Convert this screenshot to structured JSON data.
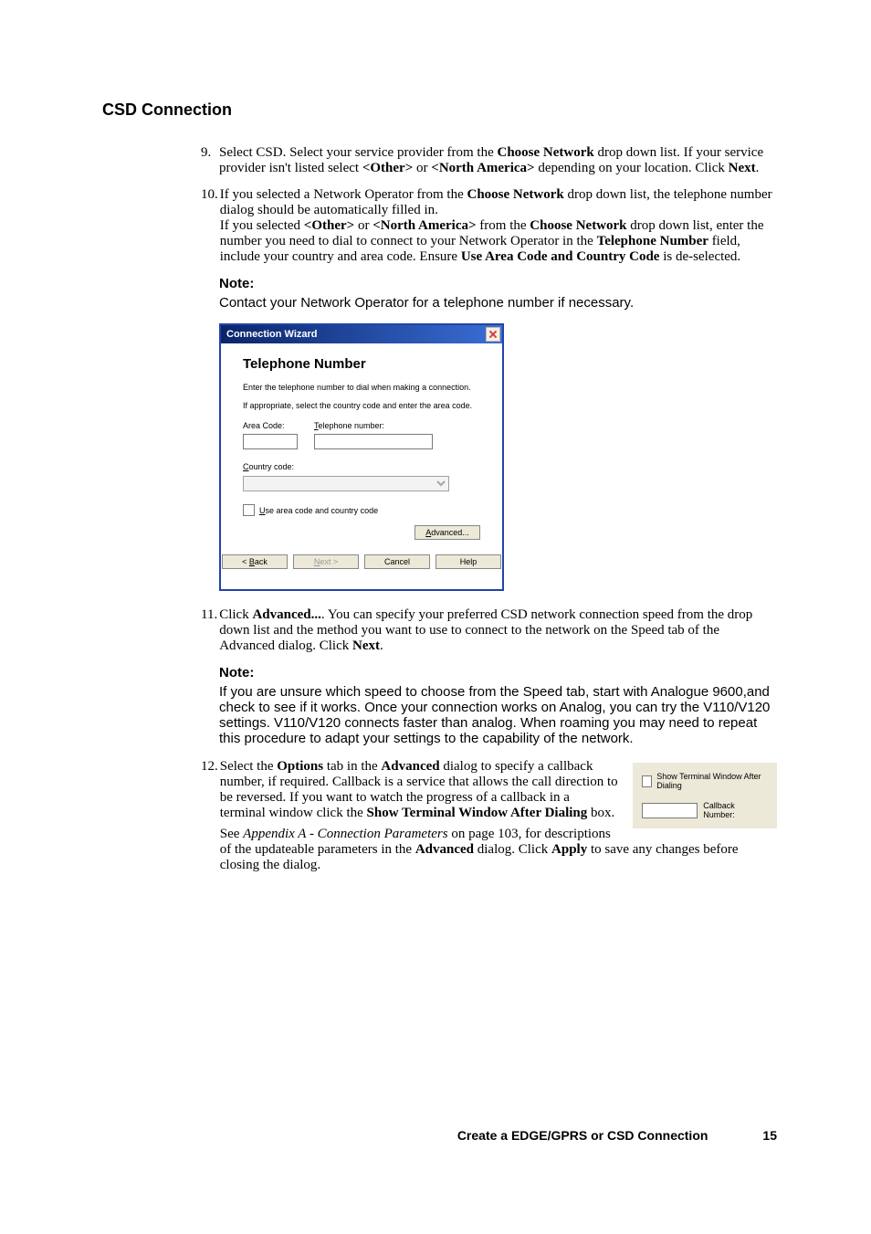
{
  "heading": "CSD Connection",
  "step9": {
    "num": "9.",
    "t1": "Select CSD. Select your service provider from the ",
    "b1": "Choose Network",
    "t2": " drop down list. If your service provider isn't listed select ",
    "b2": "<Other>",
    "t3": " or ",
    "b3": "<North America>",
    "t4": " depending on your location. Click ",
    "b4": "Next",
    "t5": "."
  },
  "step10": {
    "num": "10.",
    "t1": "If you selected a Network Operator from the ",
    "b1": "Choose Network",
    "t2": " drop down list, the telephone number dialog should be automatically filled in.",
    "t3": "If you selected ",
    "b2": "<Other>",
    "t4": " or ",
    "b3": "<North America>",
    "t5": " from the ",
    "b4": "Choose Network",
    "t6": " drop down list, enter the number you need to dial to connect to your Network Operator in the ",
    "b5": "Telephone Number",
    "t7": " field, include your country and area code. Ensure ",
    "b6": "Use Area Code and Country Code",
    "t8": " is de-selected."
  },
  "note1": {
    "label": "Note:",
    "text": "Contact your Network Operator for a telephone number if necessary."
  },
  "wizard": {
    "title": "Connection Wizard",
    "heading": "Telephone Number",
    "line1": "Enter the telephone number to dial when making a connection.",
    "line2": "If appropriate, select the country code and enter the area code.",
    "area_label_pre": "Area Code:",
    "tel_label_pre": "T",
    "tel_label_post": "elephone number:",
    "country_label_pre": "C",
    "country_label_post": "ountry code:",
    "use_area_pre": "U",
    "use_area_post": "se area code and country code",
    "advanced_pre": "A",
    "advanced_post": "dvanced...",
    "back_pre": "< ",
    "back_u": "B",
    "back_post": "ack",
    "next_pre": "",
    "next_u": "N",
    "next_post": "ext >",
    "cancel": "Cancel",
    "help": "Help"
  },
  "step11": {
    "num": "11.",
    "t1": "Click ",
    "b1": "Advanced...",
    "t2": ". You can specify your preferred CSD network connection speed from the drop down list and the method you want to use to connect to the network on the Speed tab of the Advanced dialog. Click ",
    "b2": "Next",
    "t3": "."
  },
  "note2": {
    "label": "Note:",
    "text": "If you are unsure which speed to choose from the Speed tab, start with Analogue 9600,and check to see if it works. Once your connection works on Analog, you can try the V110/V120 settings. V110/V120 connects faster than analog. When roaming you may need to repeat this procedure to adapt your settings to the capability of the network."
  },
  "options_snippet": {
    "show_terminal": "Show Terminal Window After Dialing",
    "callback_label": "Callback Number:"
  },
  "step12": {
    "num": "12.",
    "t1": "Select the ",
    "b1": "Options",
    "t2": " tab in the ",
    "b2": "Advanced",
    "t3": " dialog to specify a callback number, if required. Callback is a service that allows the call direction to be reversed. If you want to watch the progress of a callback in a terminal window click the ",
    "b3": "Show Terminal Window After Dialing",
    "t4": " box.",
    "see1": "See ",
    "see_italic": "Appendix A - Connection Parameters",
    "see2": " on page 103, for descriptions of the updateable parameters in the ",
    "b4": "Advanced",
    "see3": " dialog. Click ",
    "b5": "Apply",
    "see4": " to save any changes before closing the dialog."
  },
  "footer": {
    "title": "Create a EDGE/GPRS or CSD Connection",
    "page": "15"
  }
}
